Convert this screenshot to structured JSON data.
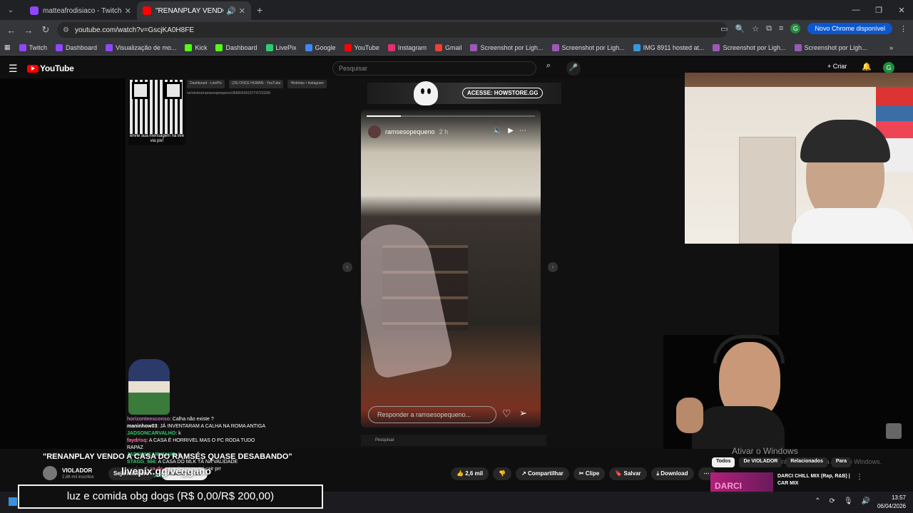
{
  "browser": {
    "tabs": [
      {
        "title": "matteafrodisiaco - Twitch",
        "color": "#9146ff"
      },
      {
        "title": "\"RENANPLAY VENDO A CA",
        "color": "#ff0000"
      }
    ],
    "url": "youtube.com/watch?v=GscjKA0H8FE",
    "update_label": "Novo Chrome disponível",
    "profile_initial": "G",
    "bookmarks": [
      {
        "label": "Twitch",
        "color": "#9146ff"
      },
      {
        "label": "Dashboard",
        "color": "#9146ff"
      },
      {
        "label": "Visualização de mo...",
        "color": "#9146ff"
      },
      {
        "label": "Kick",
        "color": "#53fc18"
      },
      {
        "label": "Dashboard",
        "color": "#53fc18"
      },
      {
        "label": "LivePix",
        "color": "#2ecc71"
      },
      {
        "label": "Google",
        "color": "#4285f4"
      },
      {
        "label": "YouTube",
        "color": "#ff0000"
      },
      {
        "label": "Instagram",
        "color": "#e1306c"
      },
      {
        "label": "Gmail",
        "color": "#ea4335"
      },
      {
        "label": "Screenshot por Ligh...",
        "color": "#9b59b6"
      },
      {
        "label": "Screenshot por Ligh...",
        "color": "#9b59b6"
      },
      {
        "label": "IMG 8911 hosted at...",
        "color": "#3498db"
      },
      {
        "label": "Screenshot por Ligh...",
        "color": "#9b59b6"
      },
      {
        "label": "Screenshot por Ligh...",
        "color": "#9b59b6"
      }
    ]
  },
  "youtube": {
    "logo": "YouTube",
    "search_placeholder": "Pesquisar",
    "create_label": "+ Criar",
    "avatar_initial": "G"
  },
  "stream": {
    "qr_caption": "envie sua mensagem na live via pix!",
    "inner_tabs": [
      "Dashboard - LivePix",
      "(26) ONCE HUMAN - YouTube",
      "Histórias • Instagram"
    ],
    "inner_url": "ne/stories/ramsesopequeno/3666642615774723328/",
    "promo_button": "ACESSE: HOWSTORE.GG",
    "story_user": "ramsesopequeno",
    "story_time": "2 h",
    "story_reply_placeholder": "Responder a ramsesopequeno...",
    "inner_search": "Pesquisar",
    "chat": [
      {
        "user": "horizonteesconso",
        "text": ": Calha não existe ?",
        "color": "#c070c0"
      },
      {
        "user": "maninhow03",
        "text": ": JÁ INVENTARAM A CALHA NA ROMA ANTIGA",
        "color": "#fff"
      },
      {
        "user": "JADSONCARVALHO",
        "text": ": k",
        "color": "#2ecc71"
      },
      {
        "user": "faydrisq",
        "text": ": A CASA É HORRIVEL MAS O PC RODA TUDO RAPAZ",
        "color": "#ff6ea8"
      },
      {
        "user": "JADSONCARVALHO",
        "text": ": k",
        "color": "#2ecc71"
      },
      {
        "user": "STAGG_666",
        "text": ": A CASA DO MLK TÁ NA VALIDADE",
        "color": "#2ecc71"
      },
      {
        "user": "queimadura-de-primeiro-gr...",
        "text": ": vai cair prr",
        "color": "#ff6ea8"
      },
      {
        "user": "JADSONCARVALHO",
        "text": ": k",
        "color": "#2ecc71"
      }
    ],
    "overlay_text": "livepix.gg/veggano",
    "donation_bar": "luz e comida obg dogs (R$ 0,00/R$ 200,00)"
  },
  "video": {
    "title": "\"RENANPLAY VENDO A CASA DO RAMSÉS QUASE DESABANDO\"",
    "channel": "VIOLADOR",
    "subscribers": "2,86 mil inscritos",
    "join_label": "Seja membro",
    "subscribe_label": "Inscrever-se",
    "likes": "2,6 mil",
    "share_label": "Compartilhar",
    "clip_label": "Clipe",
    "save_label": "Salvar",
    "download_label": "Download"
  },
  "sidebar": {
    "chips": [
      "Todos",
      "De VIOLADOR",
      "Relacionados",
      "Para"
    ],
    "recommendation_title": "DARCI CHILL MIX (Rap, R&B) | CAR MIX",
    "recommendation_thumb": "DARCI"
  },
  "windows": {
    "activate_title": "Ativar o Windows",
    "activate_sub": "Acesse Configurações para ativar o Windows.",
    "time": "13:57",
    "date": "06/04/2026"
  }
}
